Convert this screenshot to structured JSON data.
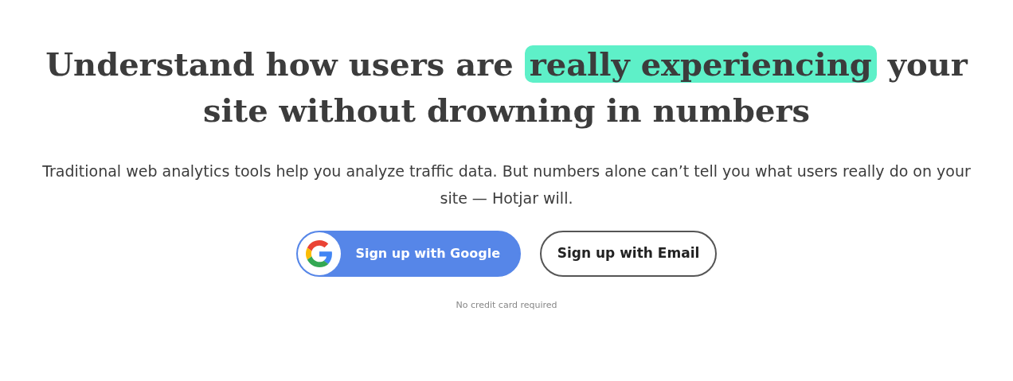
{
  "headline": [
    {
      "text": "Understand how users are ",
      "highlighted": false
    },
    {
      "text": "really experiencing",
      "highlighted": true
    },
    {
      "text": " your site without drowning in numbers",
      "highlighted": false
    }
  ],
  "subtitle": "Traditional web analytics tools help you analyze traffic data. But numbers alone can’t tell you what users really do on your site — Hotjar will.",
  "buttons": [
    {
      "label": "Sign up with Google",
      "kind": "google"
    },
    {
      "label": "Sign up with Email",
      "kind": "outline"
    }
  ],
  "note": "No credit card required"
}
